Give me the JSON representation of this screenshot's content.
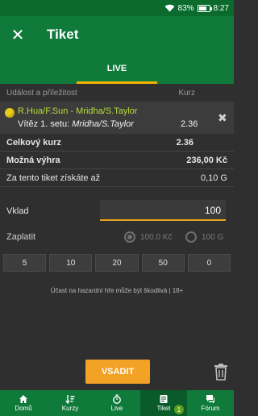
{
  "statusbar": {
    "battery": "83%",
    "time": "8:27",
    "battery_level": 0.83
  },
  "appbar": {
    "title": "Tiket"
  },
  "tabs": {
    "live": "LIVE"
  },
  "columns": {
    "event": "Událost a příležitost",
    "odds": "Kurz"
  },
  "event": {
    "name": "R.Hua/F.Sun - Mridha/S.Taylor",
    "selection_prefix": "Vítěz 1. setu: ",
    "selection_value": "Mridha/S.Taylor",
    "odd": "2.36"
  },
  "summary": {
    "total_odds_label": "Celkový kurz",
    "total_odds_value": "2.36",
    "win_label": "Možná výhra",
    "win_value": "236,00 Kč",
    "earn_label": "Za tento tiket získáte až",
    "earn_value": "0,10 G"
  },
  "stake": {
    "label": "Vklad",
    "value": "100"
  },
  "pay": {
    "label": "Zaplatit",
    "option1": "100,0 Kč",
    "option2": "100 G"
  },
  "chips": [
    "5",
    "10",
    "20",
    "50",
    "0"
  ],
  "notice": "Účast na hazardní hře může být škodlivá | 18+",
  "actions": {
    "submit": "VSADIT"
  },
  "nav": [
    {
      "label": "Domů",
      "icon": "home-icon"
    },
    {
      "label": "Kurzy",
      "icon": "sort-icon"
    },
    {
      "label": "Live",
      "icon": "stopwatch-icon"
    },
    {
      "label": "Tiket",
      "icon": "ticket-icon",
      "badge": "1"
    },
    {
      "label": "Fórum",
      "icon": "forum-icon"
    }
  ],
  "colors": {
    "primary_green": "#0f7a3a",
    "accent_orange": "#f2a225",
    "event_name": "#b7dc3a"
  }
}
